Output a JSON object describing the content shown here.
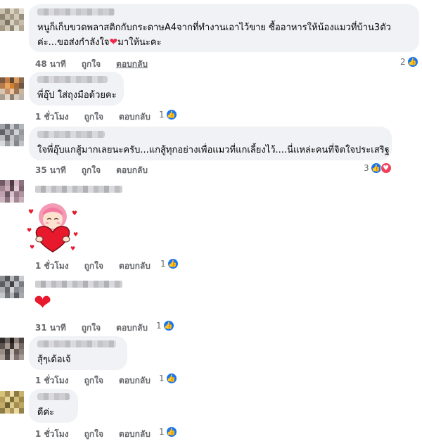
{
  "comments": [
    {
      "text_lines": [
        "หนูก็เก็บขวดพลาสติกกับกระดาษA4จากที่ทำงานเอาไว้ขาย ซื้ออาหารให้น้องแมวที่บ้าน3ตัว",
        "ค่ะ...ขอส่งกำลังใจ",
        "มาให้นะคะ"
      ],
      "time": "48 นาที",
      "like": "ถูกใจ",
      "reply": "ตอบกลับ",
      "reaction_count": "2",
      "reactions": [
        "like-icon"
      ]
    },
    {
      "text": "พี่อุ๊ป ใส่ถุงมือด้วยคะ",
      "time": "1 ชั่วโมง",
      "like": "ถูกใจ",
      "reply": "ตอบกลับ",
      "reaction_count": "1",
      "reactions": [
        "like-icon"
      ]
    },
    {
      "text": "ใจพี่อุ๊บแกสู้มากเลยนะครับ...แกสู้ทุกอย่างเพื่อแมวที่แกเลี้ยงไว้....นี่แหล่ะคนที่จิตใจประเสริฐ",
      "time": "35 นาที",
      "like": "ถูกใจ",
      "reply": "ตอบกลับ",
      "reaction_count": "3",
      "reactions": [
        "like-icon",
        "love-icon"
      ]
    },
    {
      "sticker": "girl-hugging-heart-sticker",
      "time": "1 ชั่วโมง",
      "like": "ถูกใจ",
      "reply": "ตอบกลับ",
      "reaction_count": "1",
      "reactions": [
        "like-icon"
      ]
    },
    {
      "emoji": "❤",
      "time": "31 นาที",
      "like": "ถูกใจ",
      "reply": "ตอบกลับ",
      "reaction_count": "1",
      "reactions": [
        "like-icon"
      ]
    },
    {
      "text": "สุ้ๆเด้อเจ้",
      "time": "1 ชั่วโมง",
      "like": "ถูกใจ",
      "reply": "ตอบกลับ",
      "reaction_count": "1",
      "reactions": [
        "like-icon"
      ]
    },
    {
      "text": "ดีค่ะ",
      "time": "1 ชั่วโมง",
      "like": "ถูกใจ",
      "reply": "ตอบกลับ",
      "reaction_count": "1",
      "reactions": [
        "like-icon"
      ]
    }
  ],
  "colors": {
    "like": "#1877f2",
    "love": "#f33e58",
    "bubble": "#f0f2f5",
    "meta": "#65676b"
  }
}
